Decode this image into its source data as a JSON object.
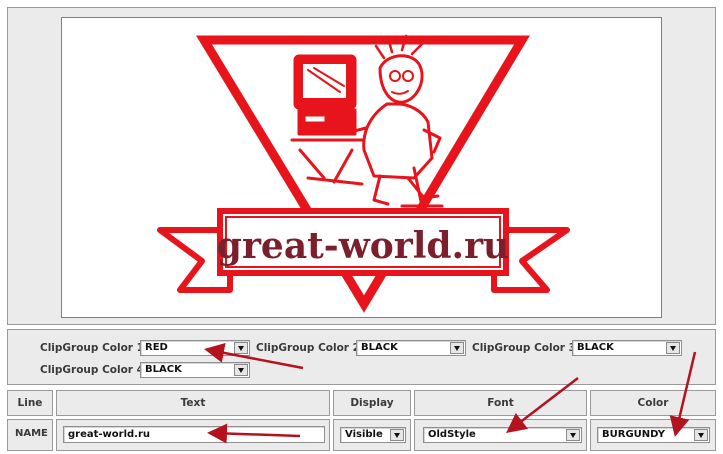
{
  "banner": {
    "text": "great-world.ru"
  },
  "clip_groups": [
    {
      "label": "ClipGroup Color 1",
      "value": "RED"
    },
    {
      "label": "ClipGroup Color 2",
      "value": "BLACK"
    },
    {
      "label": "ClipGroup Color 3",
      "value": "BLACK"
    },
    {
      "label": "ClipGroup Color 4",
      "value": "BLACK"
    }
  ],
  "table": {
    "headers": {
      "line": "Line",
      "text": "Text",
      "display": "Display",
      "font": "Font",
      "color": "Color"
    },
    "row": {
      "line": "NAME",
      "text": "great-world.ru",
      "display": "Visible",
      "font": "OldStyle",
      "color": "BURGUNDY"
    }
  },
  "colors": {
    "logo_red": "#e8141c",
    "banner_text": "#7a1f2b",
    "annotation_arrow": "#b3121e"
  }
}
